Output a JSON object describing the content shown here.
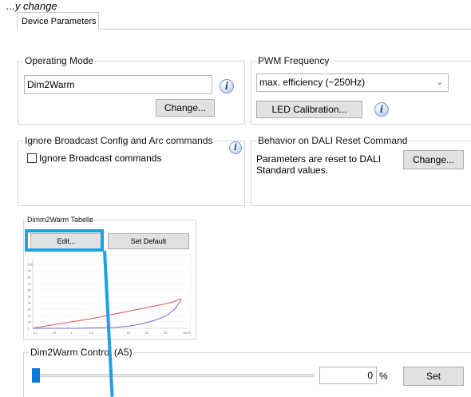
{
  "caption": "...y change",
  "tab": {
    "label": "Device Parameters"
  },
  "operating_mode": {
    "legend": "Operating Mode",
    "value": "Dim2Warm",
    "change_label": "Change...",
    "info": "i"
  },
  "pwm_frequency": {
    "legend": "PWM Frequency",
    "selected": "max. efficiency (~250Hz)",
    "calibration_label": "LED Calibration...",
    "info": "i"
  },
  "ignore_broadcast": {
    "legend": "Ignore Broadcast Config and Arc commands",
    "checkbox_label": "Ignore Broadcast commands",
    "checked": false,
    "info": "i"
  },
  "dali_reset": {
    "legend": "Behavior on DALI Reset Command",
    "description_line1": "Parameters are reset to DALI",
    "description_line2": "Standard values.",
    "change_label": "Change..."
  },
  "dimm2warm_table": {
    "legend": "Dimm2Warm Tabelle",
    "edit_label": "Edit...",
    "set_default_label": "Set Default",
    "x_ticks": [
      "0.1",
      "0.5",
      "1",
      "2.5",
      "5",
      "10",
      "25",
      "50",
      "100 %"
    ],
    "y_ticks": [
      "100",
      "90",
      "80",
      "70",
      "60",
      "50",
      "40",
      "30",
      "20",
      "10",
      "0"
    ]
  },
  "dim2warm_control": {
    "legend": "Dim2Warm Control (A5)",
    "value": "0",
    "unit": "%",
    "set_label": "Set",
    "slider_fraction": 0
  },
  "colors": {
    "highlight": "#1ea0e6",
    "red_curve": "#e05050",
    "blue_curve": "#6a6ae0"
  }
}
